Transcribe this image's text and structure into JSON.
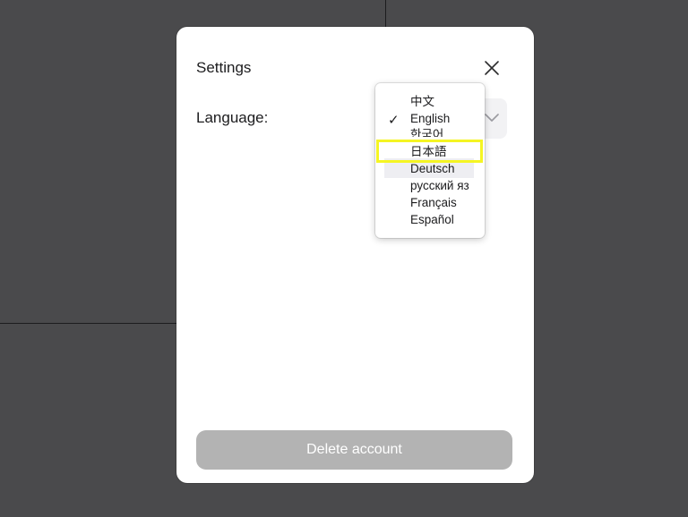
{
  "dialog": {
    "title": "Settings",
    "language_label": "Language:",
    "delete_label": "Delete account"
  },
  "language_menu": {
    "selected": "English",
    "options": [
      "中文",
      "English",
      "한국어",
      "日本語",
      "Deutsch",
      "русский яз",
      "Français",
      "Español"
    ],
    "highlighted": "日本語"
  },
  "icons": {
    "close": "close-icon",
    "check": "checkmark-icon",
    "chevron": "chevron-down-icon"
  },
  "colors": {
    "backdrop": "#4a4a4c",
    "button_disabled": "#b3b3b3",
    "highlight": "#f5f523"
  }
}
